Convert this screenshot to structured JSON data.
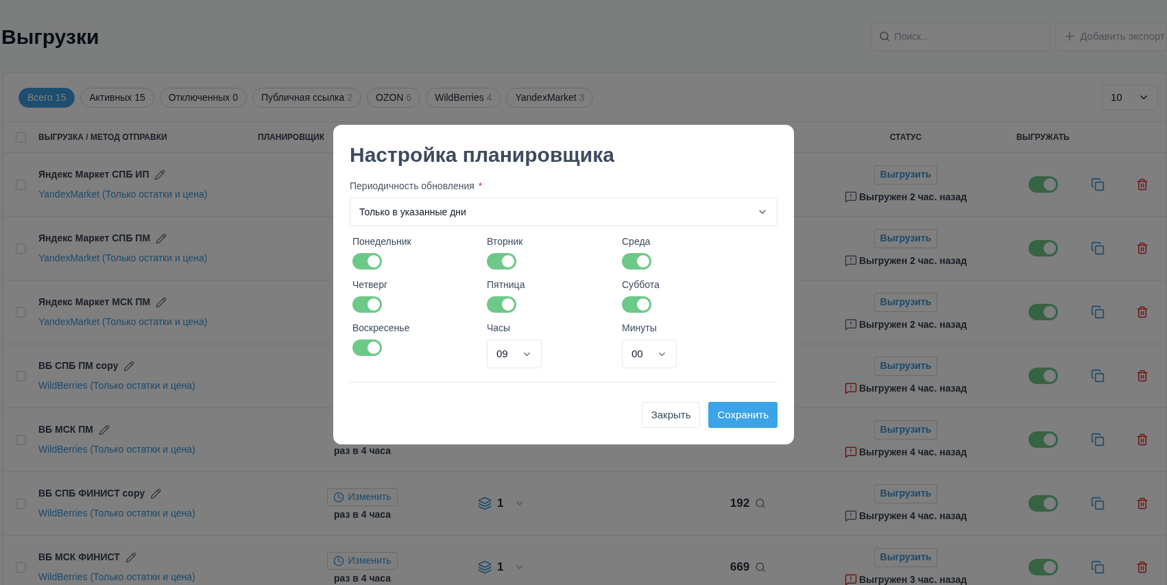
{
  "page": {
    "title": "Выгрузки",
    "search": {
      "placeholder": "Поиск..."
    },
    "add_button": "Добавить экспорт"
  },
  "filters": [
    {
      "label": "Всего",
      "count": "15",
      "selected": true,
      "count_muted": false
    },
    {
      "label": "Активных",
      "count": "15",
      "selected": false,
      "count_muted": false
    },
    {
      "label": "Отключенных",
      "count": "0",
      "selected": false,
      "count_muted": false
    },
    {
      "label": "Публичная ссылка",
      "count": "2",
      "selected": false,
      "count_muted": true
    },
    {
      "label": "OZON",
      "count": "6",
      "selected": false,
      "count_muted": true
    },
    {
      "label": "WildBerries",
      "count": "4",
      "selected": false,
      "count_muted": true
    },
    {
      "label": "YandexMarket",
      "count": "3",
      "selected": false,
      "count_muted": true
    }
  ],
  "page_size": "10",
  "table": {
    "select_all_checked": false,
    "columns": [
      "ВЫГРУЗКА / МЕТОД ОТПРАВКИ",
      "ПЛАНИРОВЩИК",
      "СТАТУС",
      "ВЫГРУЖАТЬ"
    ],
    "rows": [
      {
        "checked": false,
        "name": "Яндекс Маркет СПБ ИП",
        "method": "YandexMarket (Только остатки и цена)",
        "upload_button": "Выгрузить",
        "status": "Выгружен 2 час. назад",
        "status_alert": false,
        "enabled": true
      },
      {
        "checked": false,
        "name": "Яндекс Маркет СПБ ПМ",
        "method": "YandexMarket (Только остатки и цена)",
        "upload_button": "Выгрузить",
        "status": "Выгружен 2 час. назад",
        "status_alert": false,
        "enabled": true
      },
      {
        "checked": false,
        "name": "Яндекс Маркет МСК ПМ",
        "method": "YandexMarket (Только остатки и цена)",
        "upload_button": "Выгрузить",
        "status": "Выгружен 2 час. назад",
        "status_alert": false,
        "enabled": true
      },
      {
        "checked": false,
        "name": "ВБ СПБ ПМ copy",
        "method": "WildBerries (Только остатки и цена)",
        "upload_button": "Выгрузить",
        "status": "Выгружен 4 час. назад",
        "status_alert": true,
        "enabled": true
      },
      {
        "checked": false,
        "name": "ВБ МСК ПМ",
        "method": "WildBerries (Только остатки и цена)",
        "schedule": "раз в 4 часа",
        "upload_button": "Выгрузить",
        "status": "Выгружен 4 час. назад",
        "status_alert": true,
        "enabled": true
      },
      {
        "checked": false,
        "name": "ВБ СПБ ФИНИСТ copy",
        "method": "WildBerries (Только остатки и цена)",
        "schedule_button": "Изменить",
        "schedule": "раз в 4 часа",
        "layers": "1",
        "count": "192",
        "upload_button": "Выгрузить",
        "status": "Выгружен 4 час. назад",
        "status_alert": false,
        "enabled": true
      },
      {
        "checked": false,
        "name": "ВБ МСК ФИНИСТ",
        "method": "WildBerries (Только остатки и цена)",
        "schedule_button": "Изменить",
        "schedule": "раз в 4 часа",
        "layers": "1",
        "count": "669",
        "upload_button": "Выгрузить",
        "status": "Выгружен 3 час. назад",
        "status_alert": true,
        "enabled": true
      }
    ]
  },
  "modal": {
    "title": "Настройка планировщика",
    "frequency_label": "Периодичность обновления",
    "required_mark": "*",
    "frequency_value": "Только в указанные дни",
    "days": [
      {
        "label": "Понедельник",
        "on": true
      },
      {
        "label": "Вторник",
        "on": true
      },
      {
        "label": "Среда",
        "on": true
      },
      {
        "label": "Четверг",
        "on": true
      },
      {
        "label": "Пятница",
        "on": true
      },
      {
        "label": "Суббота",
        "on": true
      },
      {
        "label": "Воскресенье",
        "on": true
      }
    ],
    "hours": {
      "label": "Часы",
      "value": "09"
    },
    "minutes": {
      "label": "Минуты",
      "value": "00"
    },
    "buttons": [
      {
        "label": "Закрыть",
        "kind": "secondary"
      },
      {
        "label": "Сохранить",
        "kind": "primary"
      }
    ]
  }
}
